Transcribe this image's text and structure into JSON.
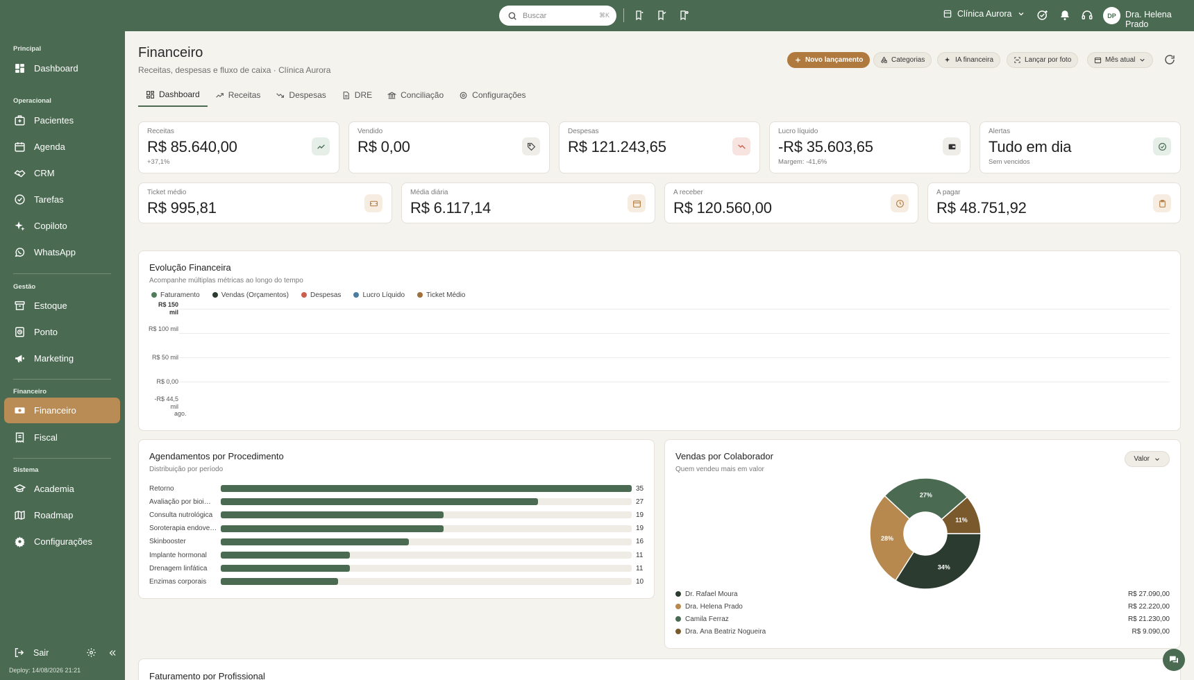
{
  "topbar": {
    "search_placeholder": "Buscar",
    "search_shortcut": "⌘K",
    "clinic": "Clínica Aurora",
    "avatar_initials": "DP",
    "user_name": "Dra. Helena Prado"
  },
  "sidebar": {
    "sections": {
      "principal": "Principal",
      "operacional": "Operacional",
      "gestao": "Gestão",
      "financeiro": "Financeiro",
      "sistema": "Sistema"
    },
    "items": {
      "dashboard": "Dashboard",
      "pacientes": "Pacientes",
      "agenda": "Agenda",
      "crm": "CRM",
      "tarefas": "Tarefas",
      "copiloto": "Copiloto",
      "whatsapp": "WhatsApp",
      "estoque": "Estoque",
      "ponto": "Ponto",
      "marketing": "Marketing",
      "financeiro": "Financeiro",
      "fiscal": "Fiscal",
      "academia": "Academia",
      "roadmap": "Roadmap",
      "configuracoes": "Configurações"
    },
    "logout": "Sair",
    "deploy": "Deploy: 14/08/2026 21:21"
  },
  "header": {
    "title": "Financeiro",
    "subtitle": "Receitas, despesas e fluxo de caixa · Clínica Aurora",
    "buttons": {
      "novo": "Novo lançamento",
      "categorias": "Categorias",
      "ia": "IA financeira",
      "foto": "Lançar por foto",
      "mes": "Mês atual"
    }
  },
  "tabs": {
    "dashboard": "Dashboard",
    "receitas": "Receitas",
    "despesas": "Despesas",
    "dre": "DRE",
    "conciliacao": "Conciliação",
    "configuracoes": "Configurações"
  },
  "kpis": {
    "receitas": {
      "label": "Receitas",
      "value": "R$ 85.640,00",
      "sub": "+37,1%"
    },
    "vendido": {
      "label": "Vendido",
      "value": "R$ 0,00"
    },
    "despesas": {
      "label": "Despesas",
      "value": "R$ 121.243,65"
    },
    "lucro": {
      "label": "Lucro líquido",
      "value": "-R$ 35.603,65",
      "sub": "Margem: -41,6%"
    },
    "alertas": {
      "label": "Alertas",
      "value": "Tudo em dia",
      "sub": "Sem vencidos"
    },
    "ticket": {
      "label": "Ticket médio",
      "value": "R$ 995,81"
    },
    "media": {
      "label": "Média diária",
      "value": "R$ 6.117,14"
    },
    "receber": {
      "label": "A receber",
      "value": "R$ 120.560,00"
    },
    "pagar": {
      "label": "A pagar",
      "value": "R$ 48.751,92"
    }
  },
  "evolucao": {
    "title": "Evolução Financeira",
    "subtitle": "Acompanhe múltiplas métricas ao longo do tempo",
    "legend": [
      {
        "name": "Faturamento",
        "color": "#4f7d5c"
      },
      {
        "name": "Vendas (Orçamentos)",
        "color": "#2b3b2f"
      },
      {
        "name": "Despesas",
        "color": "#c9604d"
      },
      {
        "name": "Lucro Líquido",
        "color": "#4a7da0"
      },
      {
        "name": "Ticket Médio",
        "color": "#a06f3a"
      }
    ],
    "yticks": [
      "R$ 150 mil",
      "R$ 100 mil",
      "R$ 50 mil",
      "R$ 0,00",
      "-R$ 44,5 mil"
    ],
    "xtick": "ago."
  },
  "agendamentos": {
    "title": "Agendamentos por Procedimento",
    "subtitle": "Distribuição por período"
  },
  "vendas": {
    "title": "Vendas por Colaborador",
    "subtitle": "Quem vendeu mais em valor",
    "dropdown": "Valor",
    "people": [
      {
        "name": "Dr. Rafael Moura",
        "value": "R$ 27.090,00",
        "color": "#2b3b2f"
      },
      {
        "name": "Dra. Helena Prado",
        "value": "R$ 22.220,00",
        "color": "#b8894f"
      },
      {
        "name": "Camila Ferraz",
        "value": "R$ 21.230,00",
        "color": "#4a6b52"
      },
      {
        "name": "Dra. Ana Beatriz Nogueira",
        "value": "R$ 9.090,00",
        "color": "#7a5a2c"
      }
    ],
    "slice_labels": [
      "34%",
      "28%",
      "27%",
      "11%"
    ]
  },
  "faturamento": {
    "title": "Faturamento por Profissional"
  },
  "chart_data": [
    {
      "type": "bar",
      "title": "Agendamentos por Procedimento",
      "categories": [
        "Retorno",
        "Avaliação por bioi…",
        "Consulta nutrológica",
        "Soroterapia endove…",
        "Skinbooster",
        "Implante hormonal",
        "Drenagem linfática",
        "Enzimas corporais"
      ],
      "values": [
        35,
        27,
        19,
        19,
        16,
        11,
        11,
        10
      ],
      "xlim": [
        0,
        35
      ]
    },
    {
      "type": "pie",
      "title": "Vendas por Colaborador",
      "categories": [
        "Dr. Rafael Moura",
        "Dra. Helena Prado",
        "Camila Ferraz",
        "Dra. Ana Beatriz Nogueira"
      ],
      "values": [
        27090,
        22220,
        21230,
        9090
      ],
      "colors": [
        "#2b3b2f",
        "#b8894f",
        "#4a6b52",
        "#7a5a2c"
      ]
    }
  ]
}
